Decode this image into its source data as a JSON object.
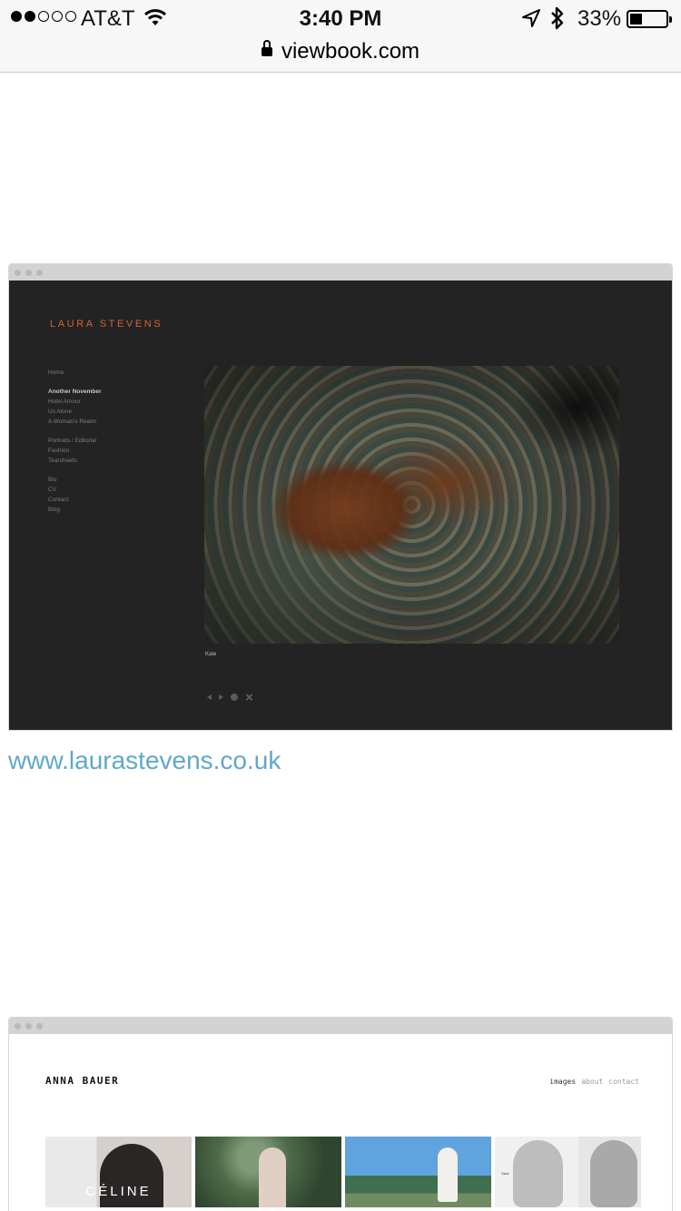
{
  "status_bar": {
    "carrier": "AT&T",
    "time": "3:40 PM",
    "battery_percent": "33%",
    "battery_level": 0.33,
    "signal_bars_filled": 2,
    "signal_bars_total": 5,
    "icons": [
      "wifi-icon",
      "location-arrow-icon",
      "bluetooth-icon",
      "battery-icon",
      "lock-icon"
    ]
  },
  "address_bar": {
    "url": "viewbook.com"
  },
  "examples": [
    {
      "site_name": "LAURA STEVENS",
      "nav": {
        "home": "Home",
        "group1": [
          "Another November",
          "Hotel Amour",
          "Us Alone",
          "A Woman's Realm"
        ],
        "group2": [
          "Portraits / Editorial",
          "Fashion",
          "Tearsheets"
        ],
        "group3": [
          "Bio",
          "CV",
          "Contact",
          "Blog"
        ]
      },
      "caption": "Kate",
      "link": "www.laurastevens.co.uk",
      "colors": {
        "background": "#232323",
        "logo": "#d1652e",
        "link": "#5fa8c8"
      }
    },
    {
      "site_name": "ANNA BAUER",
      "nav": [
        "images",
        "about",
        "contact"
      ],
      "thumb_text": "CÉLINE",
      "thumb_label": "Sara"
    }
  ]
}
